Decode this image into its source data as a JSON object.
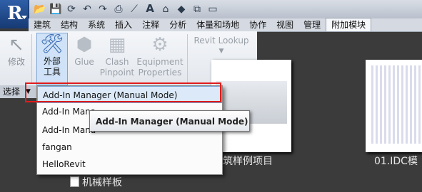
{
  "app": {
    "logo_letter": "R"
  },
  "quick_access": {
    "icons": [
      "open-icon",
      "save-icon",
      "sync-icon",
      "undo-icon",
      "redo-icon",
      "print-icon",
      "measure-icon",
      "text-icon",
      "3d-view-icon",
      "section-icon",
      "close-windows-icon",
      "switch-icon"
    ],
    "text_icon_glyph": "A"
  },
  "tabs": [
    "建筑",
    "结构",
    "系统",
    "插入",
    "注释",
    "分析",
    "体量和场地",
    "协作",
    "视图",
    "管理",
    "附加模块"
  ],
  "active_tab": "附加模块",
  "ribbon": {
    "modify_label": "修改",
    "external_tools_label_1": "外部",
    "external_tools_label_2": "工具",
    "glue_label": "Glue",
    "clash_label_1": "Clash",
    "clash_label_2": "Pinpoint",
    "equipment_label_1": "Equipment",
    "equipment_label_2": "Properties",
    "revit_lookup_label": "Revit Lookup",
    "select_panel_label": "选择",
    "lookup_panel_label_fragment": "ookup"
  },
  "menu": {
    "items": [
      "Add-In Manager (Manual Mode)",
      "Add-In Mana",
      "Add-In Mana",
      "fangan",
      "HelloRevit"
    ],
    "highlighted_index": 0
  },
  "tooltip": {
    "text": "Add-In Manager (Manual Mode)"
  },
  "recent_files": {
    "caption_1": "筑样例项目",
    "caption_2": "01.IDC模",
    "file_link": "机械样板"
  }
}
